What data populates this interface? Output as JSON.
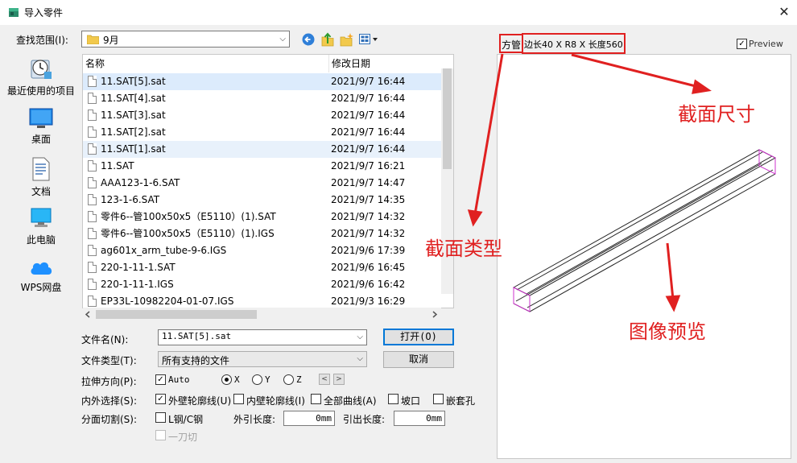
{
  "window": {
    "title": "导入零件",
    "close_glyph": "✕"
  },
  "lookin": {
    "label": "查找范围(I):",
    "value": "9月"
  },
  "sidebar": {
    "items": [
      {
        "label": "最近使用的项目",
        "icon": "recent-icon"
      },
      {
        "label": "桌面",
        "icon": "desktop-icon"
      },
      {
        "label": "文档",
        "icon": "documents-icon"
      },
      {
        "label": "此电脑",
        "icon": "computer-icon"
      },
      {
        "label": "WPS网盘",
        "icon": "cloud-icon"
      }
    ]
  },
  "filelist": {
    "col_name": "名称",
    "col_date": "修改日期",
    "rows": [
      {
        "name": "11.SAT[5].sat",
        "date": "2021/9/7 16:44"
      },
      {
        "name": "11.SAT[4].sat",
        "date": "2021/9/7 16:44"
      },
      {
        "name": "11.SAT[3].sat",
        "date": "2021/9/7 16:44"
      },
      {
        "name": "11.SAT[2].sat",
        "date": "2021/9/7 16:44"
      },
      {
        "name": "11.SAT[1].sat",
        "date": "2021/9/7 16:44"
      },
      {
        "name": "11.SAT",
        "date": "2021/9/7 16:21"
      },
      {
        "name": "AAA123-1-6.SAT",
        "date": "2021/9/7 14:47"
      },
      {
        "name": "123-1-6.SAT",
        "date": "2021/9/7 14:35"
      },
      {
        "name": "零件6--管100x50x5（E5110）(1).SAT",
        "date": "2021/9/7 14:32"
      },
      {
        "name": "零件6--管100x50x5（E5110）(1).IGS",
        "date": "2021/9/7 14:32"
      },
      {
        "name": "ag601x_arm_tube-9-6.IGS",
        "date": "2021/9/6 17:39"
      },
      {
        "name": "220-1-11-1.SAT",
        "date": "2021/9/6 16:45"
      },
      {
        "name": "220-1-11-1.IGS",
        "date": "2021/9/6 16:42"
      },
      {
        "name": "EP33L-10982204-01-07.IGS",
        "date": "2021/9/3 16:29"
      }
    ]
  },
  "form": {
    "filename_label": "文件名(N):",
    "filename_value": "11.SAT[5].sat",
    "filetype_label": "文件类型(T):",
    "filetype_value": "所有支持的文件",
    "open_label": "打开(O)",
    "cancel_label": "取消",
    "stretch_label": "拉伸方向(P):",
    "auto_label": "Auto",
    "x_label": "X",
    "y_label": "Y",
    "z_label": "Z",
    "innerouter_label": "内外选择(S):",
    "outer_contour_label": "外壁轮廓线(U)",
    "inner_contour_label": "内壁轮廓线(I)",
    "all_curves_label": "全部曲线(A)",
    "bevel_label": "坡口",
    "sleeve_hole_label": "嵌套孔",
    "split_label": "分面切割(S):",
    "lsteel_label": "L钢/C钢",
    "ext_lead_label": "外引长度:",
    "ext_lead_value": "0mm",
    "lead_out_label": "引出长度:",
    "lead_out_value": "0mm",
    "one_cut_label": "一刀切"
  },
  "preview": {
    "type_text": "方管",
    "size_text": "边长40 X R8 X 长度560",
    "checkbox_label": "Preview"
  },
  "annotations": {
    "section_size": "截面尺寸",
    "section_type": "截面类型",
    "image_preview": "图像预览"
  },
  "colors": {
    "annotation_red": "#e02020",
    "selection_blue": "#dcebfc",
    "default_button_border": "#0078d7",
    "model_magenta": "#cc33cc"
  }
}
